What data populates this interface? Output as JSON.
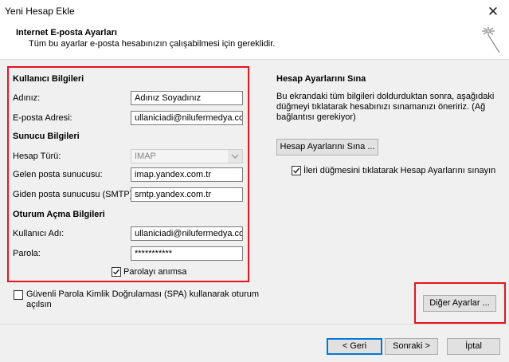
{
  "window": {
    "title": "Yeni Hesap Ekle",
    "close_glyph": "✕"
  },
  "header": {
    "title": "Internet E-posta Ayarları",
    "subtitle": "Tüm bu ayarlar e-posta hesabınızın çalışabilmesi için gereklidir."
  },
  "user_info": {
    "heading": "Kullanıcı Bilgileri",
    "name_label": "Adınız:",
    "name_value": "Adınız Soyadınız",
    "email_label": "E-posta Adresi:",
    "email_value": "ullaniciadi@nilufermedya.com"
  },
  "server_info": {
    "heading": "Sunucu Bilgileri",
    "account_type_label": "Hesap Türü:",
    "account_type_value": "IMAP",
    "incoming_label": "Gelen posta sunucusu:",
    "incoming_value": "imap.yandex.com.tr",
    "outgoing_label": "Giden posta sunucusu (SMTP):",
    "outgoing_value": "smtp.yandex.com.tr"
  },
  "logon_info": {
    "heading": "Oturum Açma Bilgileri",
    "username_label": "Kullanıcı Adı:",
    "username_value": "ullaniciadi@nilufermedya.com",
    "password_label": "Parola:",
    "password_value": "***********",
    "remember_label": "Parolayı anımsa",
    "remember_checked": true
  },
  "spa": {
    "label_line1": "Güvenli Parola Kimlik Doğrulaması (SPA) kullanarak oturum",
    "label_line2": "açılsın",
    "checked": false
  },
  "test": {
    "heading": "Hesap Ayarlarını Sına",
    "desc_line1": "Bu ekrandaki tüm bilgileri doldurduktan sonra, aşağıdaki",
    "desc_line2": "düğmeyi tıklatarak hesabınızı sınamanızı öneririz. (Ağ",
    "desc_line3": "bağlantısı gerekiyor)",
    "button_label": "Hesap Ayarlarını Sına ...",
    "auto_test_label": "İleri düğmesini tıklatarak Hesap Ayarlarını sınayın",
    "auto_test_checked": true
  },
  "buttons": {
    "more_settings": "Diğer Ayarlar ...",
    "back": "< Geri",
    "next": "Sonraki >",
    "cancel": "İptal"
  },
  "colors": {
    "highlight_red": "#e8141c",
    "primary_blue": "#0078d7"
  }
}
